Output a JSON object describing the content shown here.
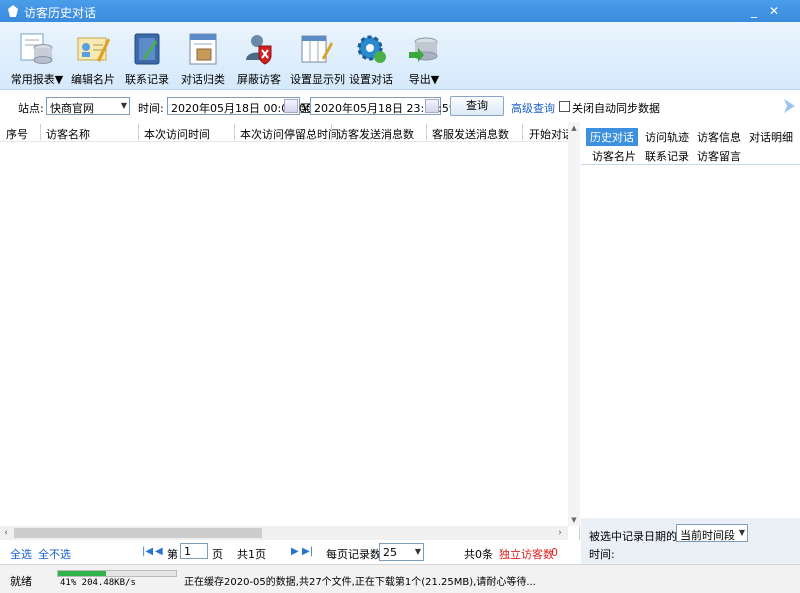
{
  "window": {
    "title": "访客历史对话",
    "minimize": "_",
    "close": "✕"
  },
  "toolbar": {
    "buttons": [
      {
        "label": "常用报表▼",
        "icon": "report-database-icon"
      },
      {
        "label": "编辑名片",
        "icon": "edit-card-icon"
      },
      {
        "label": "联系记录",
        "icon": "contact-notebook-icon"
      },
      {
        "label": "对话归类",
        "icon": "archive-icon"
      },
      {
        "label": "屏蔽访客",
        "icon": "block-visitor-icon"
      },
      {
        "label": "设置显示列",
        "icon": "columns-settings-icon"
      },
      {
        "label": "设置对话",
        "icon": "gear-settings-icon"
      },
      {
        "label": "导出▼",
        "icon": "export-icon"
      }
    ]
  },
  "filter": {
    "site_label": "站点:",
    "site_value": "快商官网",
    "time_label": "时间:",
    "from_value": "2020年05月18日  00:00:00",
    "to_label": "至",
    "to_value": "2020年05月18日  23:59:59",
    "query_button": "查询",
    "advanced_link": "高级查询",
    "auto_sync_label": "关闭自动同步数据",
    "auto_sync_checked": false
  },
  "table": {
    "columns": [
      "序号",
      "访客名称",
      "本次访问时间",
      "本次访问停留总时间",
      "访客发送消息数",
      "客服发送消息数",
      "开始对话"
    ],
    "rows": []
  },
  "right_panel": {
    "tabs_row1": [
      "历史对话",
      "访问轨迹",
      "访客信息",
      "对话明细"
    ],
    "tabs_row2": [
      "访客名片",
      "联系记录",
      "访客留言"
    ],
    "active_tab": "历史对话",
    "date_label": "被选中记录日期的:",
    "date_select": "当前时间段",
    "time_label": "时间:"
  },
  "pager": {
    "select_all": "全选",
    "select_none": "全不选",
    "page_prefix": "第",
    "page_value": "1",
    "page_suffix": "页",
    "total_pages": "共1页",
    "per_page_label": "每页记录数",
    "per_page_value": "25",
    "total_records": "共0条",
    "unique_visitors_label": "独立访客数",
    "unique_visitors_value": "0"
  },
  "status": {
    "ready": "就绪",
    "progress_percent": 41,
    "progress_text": "41%  204.48KB/s",
    "message": "正在缓存2020-05的数据,共27个文件,正在下载第1个(21.25MB),请耐心等待..."
  },
  "colors": {
    "titlebar": "#3a8ade",
    "accent": "#3d90dd",
    "link": "#1b5fc9",
    "red": "#e02020",
    "progress": "#2fb34a"
  }
}
